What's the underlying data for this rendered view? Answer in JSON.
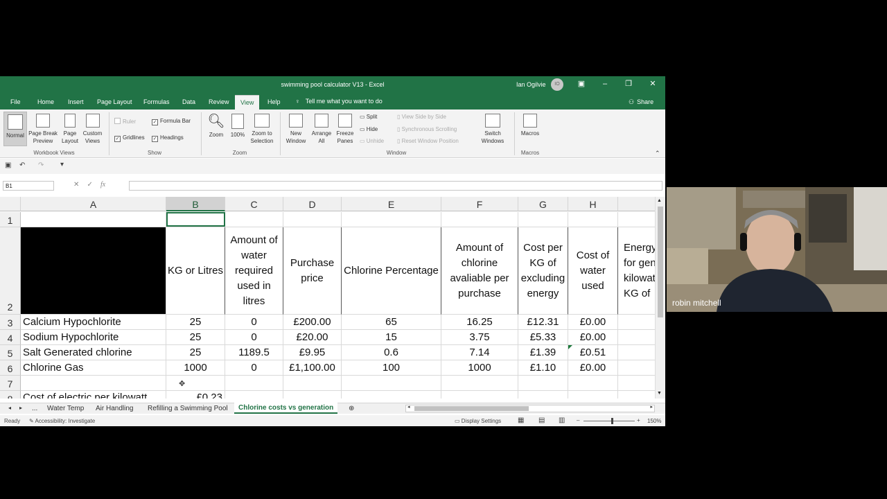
{
  "window": {
    "title": "swimming pool calculator V13  -  Excel",
    "user": "Ian Ogilvie",
    "avatar_initials": "IO"
  },
  "menu_tabs": [
    "File",
    "Home",
    "Insert",
    "Page Layout",
    "Formulas",
    "Data",
    "Review",
    "View",
    "Help"
  ],
  "active_tab": "View",
  "tell_me": "Tell me what you want to do",
  "share": "Share",
  "ribbon": {
    "workbook_views": {
      "normal": "Normal",
      "page_break_1": "Page Break",
      "page_break_2": "Preview",
      "page_layout_1": "Page",
      "page_layout_2": "Layout",
      "custom_views_1": "Custom",
      "custom_views_2": "Views",
      "group": "Workbook Views"
    },
    "show": {
      "ruler": "Ruler",
      "formula_bar": "Formula Bar",
      "gridlines": "Gridlines",
      "headings": "Headings",
      "group": "Show"
    },
    "zoom": {
      "zoom": "Zoom",
      "hundred": "100%",
      "zoom_sel_1": "Zoom to",
      "zoom_sel_2": "Selection",
      "group": "Zoom"
    },
    "window": {
      "new_window_1": "New",
      "new_window_2": "Window",
      "arrange_1": "Arrange",
      "arrange_2": "All",
      "freeze_1": "Freeze",
      "freeze_2": "Panes",
      "split": "Split",
      "hide": "Hide",
      "unhide": "Unhide",
      "side_by_side": "View Side by Side",
      "sync_scroll": "Synchronous Scrolling",
      "reset_pos": "Reset Window Position",
      "switch_1": "Switch",
      "switch_2": "Windows",
      "group": "Window"
    },
    "macros": {
      "macros": "Macros",
      "group": "Macros"
    }
  },
  "formula_bar": {
    "name_box": "B1",
    "fx": "fx",
    "value": ""
  },
  "columns": [
    "A",
    "B",
    "C",
    "D",
    "E",
    "F",
    "G",
    "H"
  ],
  "selected_column": "B",
  "rows": {
    "r1": "1",
    "r2": {
      "num": "2",
      "B": "KG or Litres",
      "C": "Amount of water required used in litres",
      "D": "Purchase price",
      "E": "Chlorine Percentage",
      "F": "Amount of chlorine avaliable per purchase",
      "G": "Cost per KG of excluding energy",
      "H": "Cost of water used",
      "I": "Energy for gen kilowat KG of"
    },
    "data": [
      {
        "num": "3",
        "A": "Calcium Hypochlorite",
        "B": "25",
        "C": "0",
        "D": "£200.00",
        "E": "65",
        "F": "16.25",
        "G": "£12.31",
        "H": "£0.00"
      },
      {
        "num": "4",
        "A": "Sodium Hypochlorite",
        "B": "25",
        "C": "0",
        "D": "£20.00",
        "E": "15",
        "F": "3.75",
        "G": "£5.33",
        "H": "£0.00"
      },
      {
        "num": "5",
        "A": "Salt Generated chlorine",
        "B": "25",
        "C": "1189.5",
        "D": "£9.95",
        "E": "0.6",
        "F": "7.14",
        "G": "£1.39",
        "H": "£0.51"
      },
      {
        "num": "6",
        "A": "Chlorine Gas",
        "B": "1000",
        "C": "0",
        "D": "£1,100.00",
        "E": "100",
        "F": "1000",
        "G": "£1.10",
        "H": "£0.00"
      }
    ],
    "r7": "7",
    "r8": {
      "num": "8",
      "A": "Cost of electric per kilowatt",
      "B": "£0.23"
    }
  },
  "sheet_tabs": {
    "more": "...",
    "tabs": [
      "Water Temp",
      "Air Handling",
      "Refilling a Swimming Pool",
      "Chlorine costs vs generation"
    ],
    "active": "Chlorine costs vs generation"
  },
  "status": {
    "ready": "Ready",
    "accessibility": "Accessibility: Investigate",
    "display": "Display Settings",
    "zoom": "150%"
  },
  "video": {
    "participant": "robin mitchell"
  }
}
